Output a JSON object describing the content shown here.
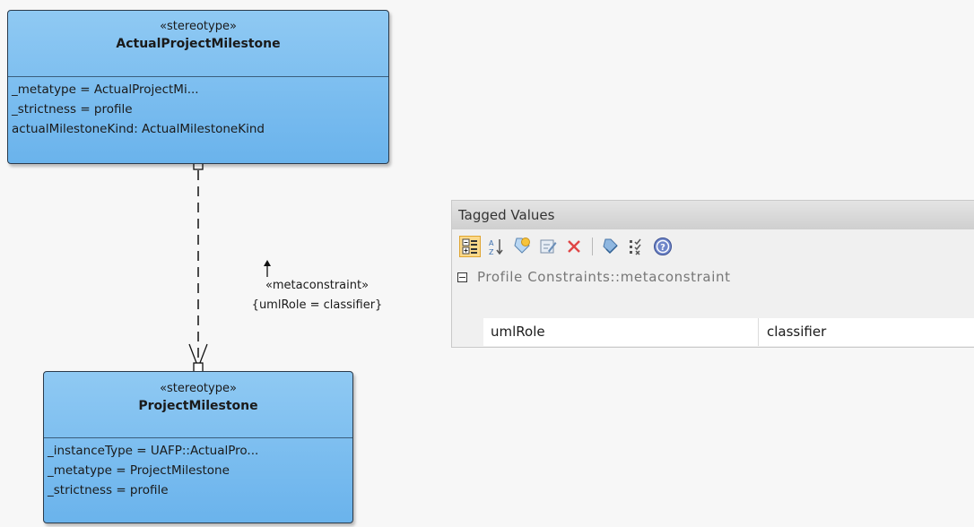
{
  "diagram": {
    "actual_class": {
      "stereotype": "«stereotype»",
      "name": "ActualProjectMilestone",
      "attributes": [
        "_metatype = ActualProjectMi...",
        "_strictness = profile",
        "actualMilestoneKind: ActualMilestoneKind"
      ]
    },
    "milestone_class": {
      "stereotype": "«stereotype»",
      "name": "ProjectMilestone",
      "attributes": [
        "_instanceType = UAFP::ActualPro...",
        "_metatype = ProjectMilestone",
        "_strictness = profile"
      ]
    },
    "connector": {
      "stereotype": "«metaconstraint»",
      "constraint": "{umlRole = classifier}"
    },
    "colors": {
      "class_fill": "#7bbdef",
      "class_border": "#2b3a4a"
    }
  },
  "tagged_values": {
    "title": "Tagged Values",
    "toolbar": [
      {
        "icon": "categorized-view-icon",
        "active": true
      },
      {
        "icon": "sort-alphabetical-icon"
      },
      {
        "icon": "new-tag-icon"
      },
      {
        "icon": "edit-tag-icon"
      },
      {
        "icon": "delete-icon"
      },
      {
        "icon": "tag-sets-icon"
      },
      {
        "icon": "checklist-icon"
      },
      {
        "icon": "help-icon"
      }
    ],
    "group": "Profile Constraints::metaconstraint",
    "rows": [
      {
        "name": "umlRole",
        "value": "classifier"
      }
    ]
  }
}
